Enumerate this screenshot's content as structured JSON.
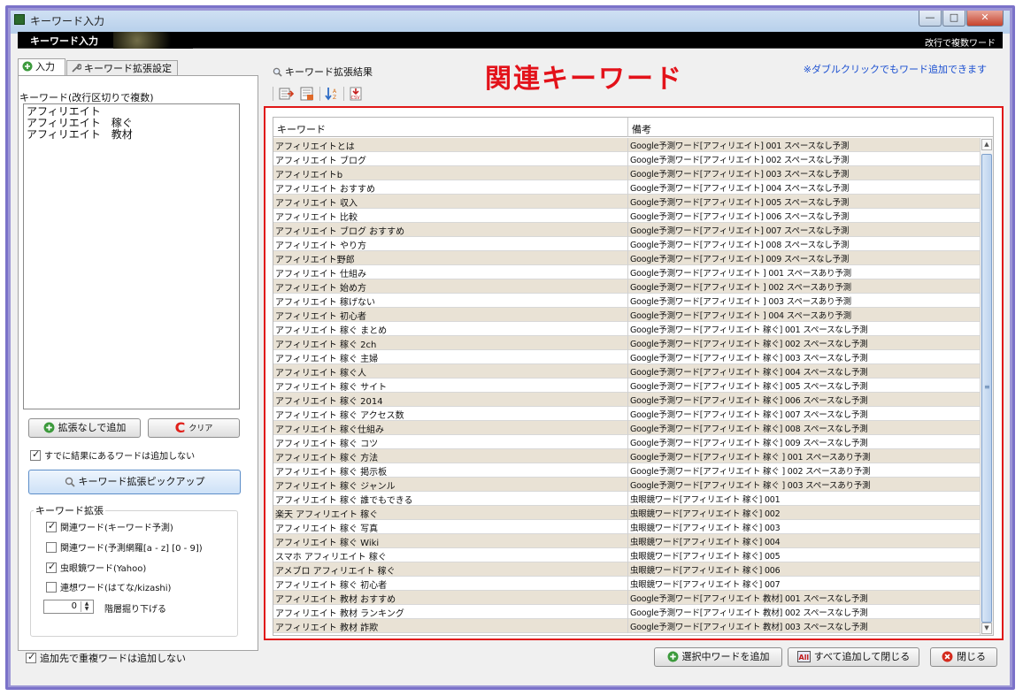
{
  "window": {
    "title": "キーワード入力",
    "min_label": "—",
    "max_label": "□",
    "close_label": "✕"
  },
  "header": {
    "title": "キーワード入力",
    "right_text": "改行で複数ワード"
  },
  "tabs": [
    {
      "label": "入力",
      "icon": "plus-circle-icon"
    },
    {
      "label": "キーワード拡張設定",
      "icon": "wrench-icon"
    }
  ],
  "input": {
    "label": "キーワード(改行区切りで複数)",
    "text": "アフィリエイト\nアフィリエイト　稼ぐ\nアフィリエイト　教材"
  },
  "buttons": {
    "add_no_expand": "拡張なしで追加",
    "clear": "クリア",
    "clear_glyph": "C",
    "pickup": "キーワード拡張ピックアップ",
    "add_selected": "選択中ワードを追加",
    "add_all_close": "すべて追加して閉じる",
    "close": "閉じる"
  },
  "options": {
    "skip_existing": {
      "label": "すでに結果にあるワードは追加しない",
      "checked": true
    },
    "no_duplicates": {
      "label": "追加先で重複ワードは追加しない",
      "checked": true
    }
  },
  "expand": {
    "group_label": "キーワード拡張",
    "items": [
      {
        "label": "関連ワード(キーワード予測)",
        "checked": true
      },
      {
        "label": "関連ワード(予測網羅[a - z] [0 - 9])",
        "checked": false
      },
      {
        "label": "虫眼鏡ワード(Yahoo)",
        "checked": true
      },
      {
        "label": "連想ワード(はてな/kizashi)",
        "checked": false
      }
    ],
    "depth_value": "0",
    "depth_label": "階層掘り下げる"
  },
  "results": {
    "label": "キーワード拡張結果",
    "big_title": "関連キーワード",
    "note": "※ダブルクリックでもワード追加できます",
    "toolbar_icons": [
      "export-icon",
      "table-icon",
      "sort-icon",
      "csv-icon"
    ],
    "columns": [
      "キーワード",
      "備考"
    ],
    "rows": [
      [
        "アフィリエイトとは",
        "Google予測ワード[アフィリエイト] 001 スペースなし予測"
      ],
      [
        "アフィリエイト ブログ",
        "Google予測ワード[アフィリエイト] 002 スペースなし予測"
      ],
      [
        "アフィリエイトb",
        "Google予測ワード[アフィリエイト] 003 スペースなし予測"
      ],
      [
        "アフィリエイト おすすめ",
        "Google予測ワード[アフィリエイト] 004 スペースなし予測"
      ],
      [
        "アフィリエイト 収入",
        "Google予測ワード[アフィリエイト] 005 スペースなし予測"
      ],
      [
        "アフィリエイト 比較",
        "Google予測ワード[アフィリエイト] 006 スペースなし予測"
      ],
      [
        "アフィリエイト ブログ おすすめ",
        "Google予測ワード[アフィリエイト] 007 スペースなし予測"
      ],
      [
        "アフィリエイト やり方",
        "Google予測ワード[アフィリエイト] 008 スペースなし予測"
      ],
      [
        "アフィリエイト野郎",
        "Google予測ワード[アフィリエイト] 009 スペースなし予測"
      ],
      [
        "アフィリエイト 仕組み",
        "Google予測ワード[アフィリエイト ] 001 スペースあり予測"
      ],
      [
        "アフィリエイト 始め方",
        "Google予測ワード[アフィリエイト ] 002 スペースあり予測"
      ],
      [
        "アフィリエイト 稼げない",
        "Google予測ワード[アフィリエイト ] 003 スペースあり予測"
      ],
      [
        "アフィリエイト 初心者",
        "Google予測ワード[アフィリエイト ] 004 スペースあり予測"
      ],
      [
        "アフィリエイト 稼ぐ まとめ",
        "Google予測ワード[アフィリエイト 稼ぐ] 001 スペースなし予測"
      ],
      [
        "アフィリエイト 稼ぐ 2ch",
        "Google予測ワード[アフィリエイト 稼ぐ] 002 スペースなし予測"
      ],
      [
        "アフィリエイト 稼ぐ 主婦",
        "Google予測ワード[アフィリエイト 稼ぐ] 003 スペースなし予測"
      ],
      [
        "アフィリエイト 稼ぐ人",
        "Google予測ワード[アフィリエイト 稼ぐ] 004 スペースなし予測"
      ],
      [
        "アフィリエイト 稼ぐ サイト",
        "Google予測ワード[アフィリエイト 稼ぐ] 005 スペースなし予測"
      ],
      [
        "アフィリエイト 稼ぐ 2014",
        "Google予測ワード[アフィリエイト 稼ぐ] 006 スペースなし予測"
      ],
      [
        "アフィリエイト 稼ぐ アクセス数",
        "Google予測ワード[アフィリエイト 稼ぐ] 007 スペースなし予測"
      ],
      [
        "アフィリエイト 稼ぐ仕組み",
        "Google予測ワード[アフィリエイト 稼ぐ] 008 スペースなし予測"
      ],
      [
        "アフィリエイト 稼ぐ コツ",
        "Google予測ワード[アフィリエイト 稼ぐ] 009 スペースなし予測"
      ],
      [
        "アフィリエイト 稼ぐ 方法",
        "Google予測ワード[アフィリエイト 稼ぐ ] 001 スペースあり予測"
      ],
      [
        "アフィリエイト 稼ぐ 掲示板",
        "Google予測ワード[アフィリエイト 稼ぐ ] 002 スペースあり予測"
      ],
      [
        "アフィリエイト 稼ぐ ジャンル",
        "Google予測ワード[アフィリエイト 稼ぐ ] 003 スペースあり予測"
      ],
      [
        "アフィリエイト 稼ぐ 誰でもできる",
        "虫眼鏡ワード[アフィリエイト 稼ぐ] 001"
      ],
      [
        "楽天 アフィリエイト 稼ぐ",
        "虫眼鏡ワード[アフィリエイト 稼ぐ] 002"
      ],
      [
        "アフィリエイト 稼ぐ 写真",
        "虫眼鏡ワード[アフィリエイト 稼ぐ] 003"
      ],
      [
        "アフィリエイト 稼ぐ Wiki",
        "虫眼鏡ワード[アフィリエイト 稼ぐ] 004"
      ],
      [
        "スマホ アフィリエイト 稼ぐ",
        "虫眼鏡ワード[アフィリエイト 稼ぐ] 005"
      ],
      [
        "アメブロ アフィリエイト 稼ぐ",
        "虫眼鏡ワード[アフィリエイト 稼ぐ] 006"
      ],
      [
        "アフィリエイト 稼ぐ 初心者",
        "虫眼鏡ワード[アフィリエイト 稼ぐ] 007"
      ],
      [
        "アフィリエイト 教材 おすすめ",
        "Google予測ワード[アフィリエイト 教材] 001 スペースなし予測"
      ],
      [
        "アフィリエイト 教材 ランキング",
        "Google予測ワード[アフィリエイト 教材] 002 スペースなし予測"
      ],
      [
        "アフィリエイト 教材 詐欺",
        "Google予測ワード[アフィリエイト 教材] 003 スペースなし予測"
      ]
    ]
  },
  "colors": {
    "accent_red": "#e3121a",
    "row_alt": "#e9e2d5",
    "note_blue": "#1a4fd1",
    "frame": "#7b72c9"
  }
}
